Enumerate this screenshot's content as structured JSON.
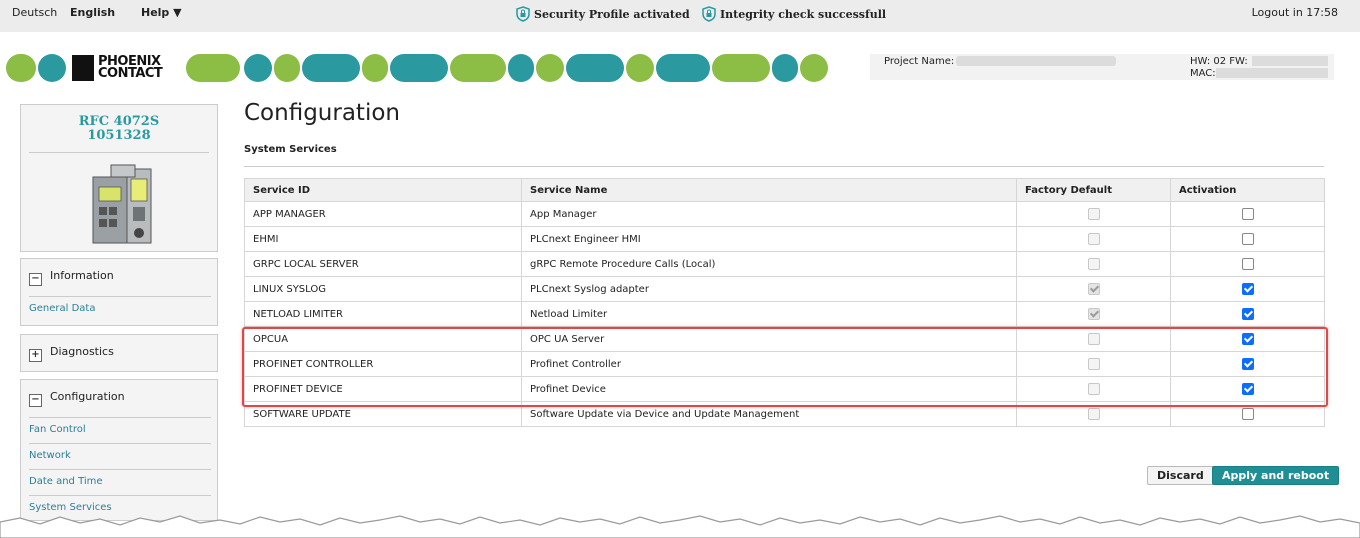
{
  "topbar": {
    "lang_de": "Deutsch",
    "lang_en": "English",
    "help": "Help ▼",
    "security": "Security Profile activated",
    "integrity": "Integrity check successfull",
    "logout": "Logout in 17:58"
  },
  "brand": {
    "line1": "PHOENIX",
    "line2": "CONTACT"
  },
  "project": {
    "name_label": "Project Name:",
    "hw_label": "HW: 02 FW:",
    "mac_label": "MAC:"
  },
  "device": {
    "model": "RFC 4072S",
    "number": "1051328"
  },
  "sidebar": {
    "information": {
      "label": "Information",
      "toggle": "−",
      "items": [
        "General Data"
      ]
    },
    "diagnostics": {
      "label": "Diagnostics",
      "toggle": "+"
    },
    "configuration": {
      "label": "Configuration",
      "toggle": "−",
      "items": [
        "Fan Control",
        "Network",
        "Date and Time",
        "System Services"
      ]
    }
  },
  "page": {
    "title": "Configuration",
    "section": "System Services"
  },
  "table": {
    "headers": [
      "Service ID",
      "Service Name",
      "Factory Default",
      "Activation"
    ],
    "rows": [
      {
        "id": "APP MANAGER",
        "name": "App Manager",
        "factory": false,
        "active": false
      },
      {
        "id": "EHMI",
        "name": "PLCnext Engineer HMI",
        "factory": false,
        "active": false
      },
      {
        "id": "GRPC LOCAL SERVER",
        "name": "gRPC Remote Procedure Calls (Local)",
        "factory": false,
        "active": false
      },
      {
        "id": "LINUX SYSLOG",
        "name": "PLCnext Syslog adapter",
        "factory": true,
        "active": true
      },
      {
        "id": "NETLOAD LIMITER",
        "name": "Netload Limiter",
        "factory": true,
        "active": true
      },
      {
        "id": "OPCUA",
        "name": "OPC UA Server",
        "factory": false,
        "active": true
      },
      {
        "id": "PROFINET CONTROLLER",
        "name": "Profinet Controller",
        "factory": false,
        "active": true
      },
      {
        "id": "PROFINET DEVICE",
        "name": "Profinet Device",
        "factory": false,
        "active": true
      },
      {
        "id": "SOFTWARE UPDATE",
        "name": "Software Update via Device and Update Management",
        "factory": false,
        "active": false
      }
    ]
  },
  "buttons": {
    "discard": "Discard",
    "apply": "Apply and reboot"
  },
  "colors": {
    "teal": "#2a9aa0",
    "green": "#8cbd45",
    "highlight": "#e04848",
    "check": "#0d6efd"
  }
}
